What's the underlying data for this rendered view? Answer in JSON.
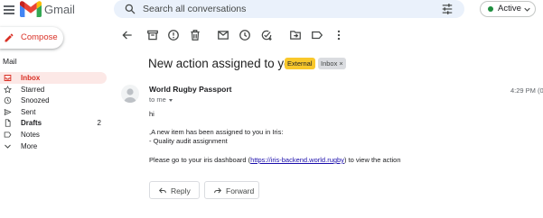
{
  "app": {
    "name": "Gmail"
  },
  "search": {
    "placeholder": "Search all conversations"
  },
  "status": {
    "label": "Active"
  },
  "sidebar": {
    "compose_label": "Compose",
    "section_label": "Mail",
    "items": [
      {
        "label": "Inbox",
        "icon": "inbox-icon",
        "count": ""
      },
      {
        "label": "Starred",
        "icon": "star-icon",
        "count": ""
      },
      {
        "label": "Snoozed",
        "icon": "clock-icon",
        "count": ""
      },
      {
        "label": "Sent",
        "icon": "send-icon",
        "count": ""
      },
      {
        "label": "Drafts",
        "icon": "draft-icon",
        "count": "2"
      },
      {
        "label": "Notes",
        "icon": "label-icon",
        "count": ""
      },
      {
        "label": "More",
        "icon": "chevron-down-icon",
        "count": ""
      }
    ]
  },
  "toolbar": {
    "icons": [
      "back-arrow-icon",
      "archive-icon",
      "report-spam-icon",
      "delete-icon",
      "mark-unread-icon",
      "snooze-icon",
      "add-task-icon",
      "move-to-icon",
      "label-icon",
      "more-vert-icon"
    ]
  },
  "message": {
    "subject": "New action assigned to you",
    "labels": {
      "external": "External",
      "inbox": "Inbox",
      "inbox_remove": "×"
    },
    "sender": "World Rugby Passport",
    "to": "to me",
    "timestamp": "4:29 PM (0",
    "body": {
      "greeting": "hi",
      "line1": ",A new item has been assigned to you in Iris:",
      "line2": "- Quality audit assignment",
      "line3_prefix": "Please go to your iris dashboard (",
      "link": "https://iris-backend.world.rugby",
      "line3_suffix": ") to view the action"
    }
  },
  "actions": {
    "reply_label": "Reply",
    "forward_label": "Forward"
  },
  "colors": {
    "accent_red": "#d93025",
    "search_bg": "#eaf1fb",
    "active_green": "#1e8e3e",
    "external_label": "#f9c82b",
    "inbox_label": "#dadce0",
    "nav_active_bg": "#fce8e6"
  }
}
